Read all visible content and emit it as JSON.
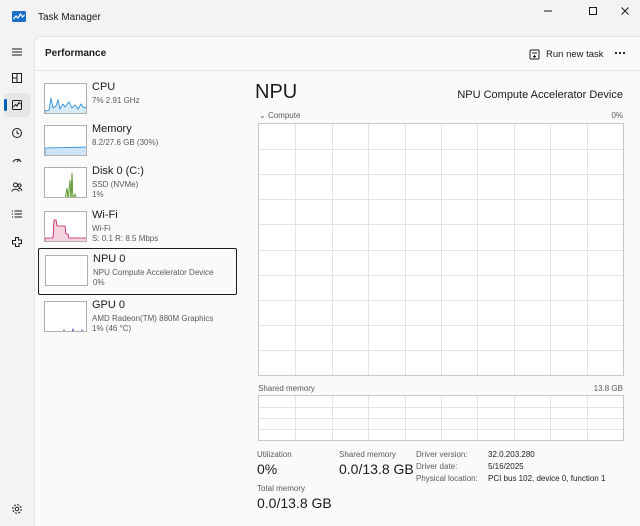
{
  "window": {
    "title": "Task Manager",
    "minimize_glyph": "—",
    "maximize_glyph": "□",
    "close_glyph": "✕"
  },
  "nav": {
    "items": [
      {
        "icon": "hamburger-menu-icon"
      },
      {
        "icon": "processes-icon"
      },
      {
        "icon": "performance-icon",
        "active": true
      },
      {
        "icon": "app-history-icon"
      },
      {
        "icon": "startup-apps-icon"
      },
      {
        "icon": "users-icon"
      },
      {
        "icon": "details-icon"
      },
      {
        "icon": "services-icon"
      },
      {
        "icon": "settings-icon"
      }
    ]
  },
  "header": {
    "title": "Performance",
    "run_new_task": "Run new task",
    "more_glyph": "•••"
  },
  "devices": [
    {
      "name": "CPU",
      "sub1": "7% 2.91 GHz",
      "sub2": "",
      "sub3": "",
      "color": "#1f87d8",
      "fill": "#d6eaf8"
    },
    {
      "name": "Memory",
      "sub1": "8.2/27.6 GB (30%)",
      "sub2": "",
      "sub3": "",
      "color": "#1f87d8",
      "fill": "#cfe5f7"
    },
    {
      "name": "Disk 0 (C:)",
      "sub1": "SSD (NVMe)",
      "sub2": "1%",
      "sub3": "",
      "color": "#4e8a1a",
      "fill": "#d8ecc6"
    },
    {
      "name": "Wi-Fi",
      "sub1": "Wi-Fi",
      "sub2": "S: 0.1  R: 8.5 Mbps",
      "sub3": "",
      "color": "#c2185b",
      "fill": "#f6d3e1"
    },
    {
      "name": "NPU 0",
      "sub1": "NPU Compute Accelerator Device",
      "sub2": "0%",
      "sub3": "",
      "color": "#1f87d8",
      "fill": "#ffffff",
      "selected": true
    },
    {
      "name": "GPU 0",
      "sub1": "AMD Radeon(TM) 880M Graphics",
      "sub2": "1%  (46 °C)",
      "sub3": "",
      "color": "#6a3fc1",
      "fill": "#e3dbf5"
    }
  ],
  "detail": {
    "heading": "NPU",
    "model": "NPU Compute Accelerator Device",
    "compute_label": "Compute",
    "compute_max": "0%",
    "shared_label": "Shared memory",
    "shared_max": "13.8 GB",
    "compute_utilization": 0,
    "shared_memory_used_gb": 0.0
  },
  "stats": {
    "utilization_label": "Utilization",
    "utilization_value": "0%",
    "shared_label": "Shared memory",
    "shared_value": "0.0/13.8 GB",
    "total_label": "Total memory",
    "total_value": "0.0/13.8 GB"
  },
  "info": {
    "driver_version_label": "Driver version:",
    "driver_version_value": "32.0.203.280",
    "driver_date_label": "Driver date:",
    "driver_date_value": "5/16/2025",
    "physical_location_label": "Physical location:",
    "physical_location_value": "PCI bus 102, device 0, function 1"
  },
  "colors": {
    "accent": "#005fb8",
    "graph_border": "#c8c8c8",
    "grid": "#e3e3e3"
  }
}
